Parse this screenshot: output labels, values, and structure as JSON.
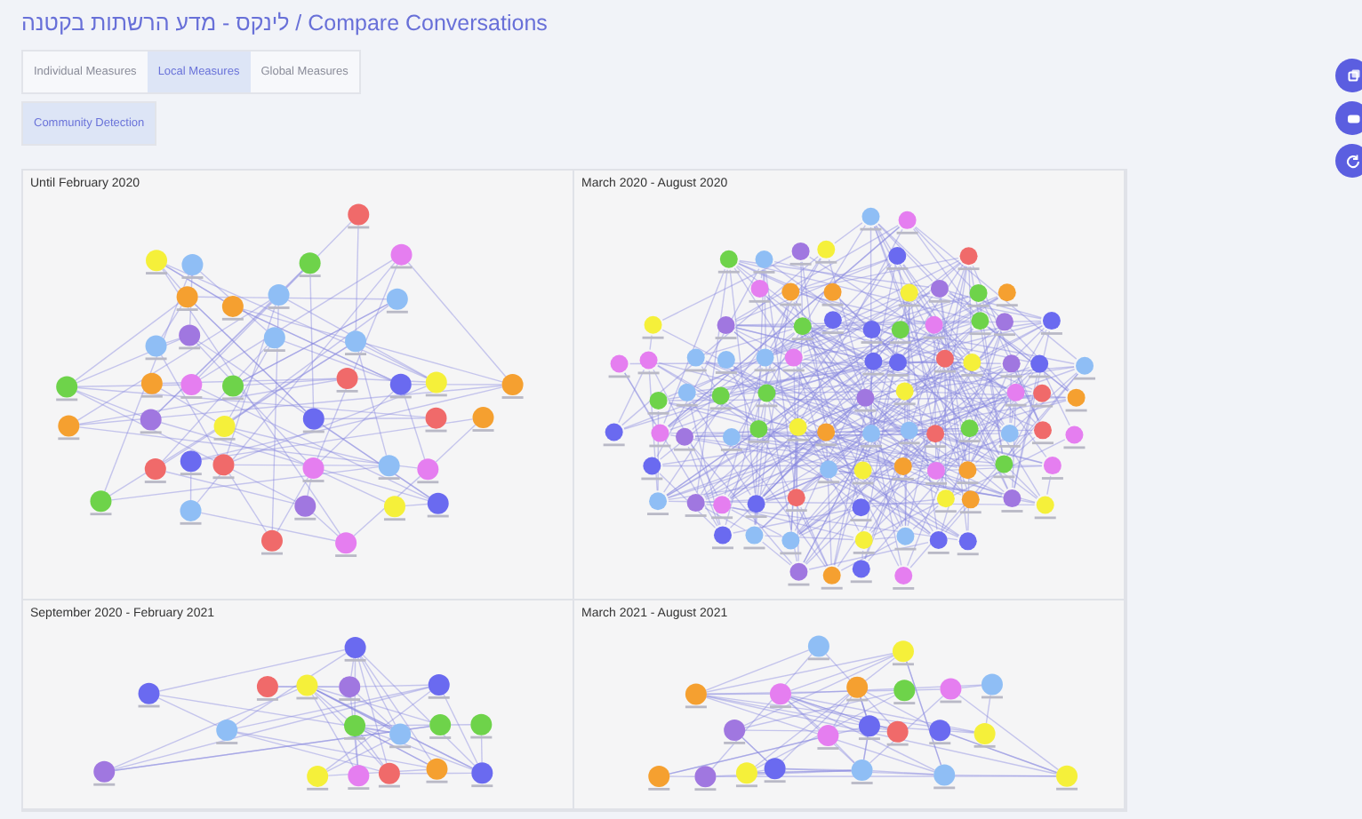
{
  "header": {
    "title": "לינקס - מדע הרשתות בקטנה / Compare Conversations"
  },
  "tabs": [
    {
      "label": "Individual Measures",
      "selected": false
    },
    {
      "label": "Local Measures",
      "selected": true
    },
    {
      "label": "Global Measures",
      "selected": false
    }
  ],
  "subtabs": [
    {
      "label": "Community Detection",
      "selected": true
    }
  ],
  "panels": [
    {
      "title": "Until February 2020"
    },
    {
      "title": "March 2020 - August 2020"
    },
    {
      "title": "September 2020 - February 2021"
    },
    {
      "title": "March 2021 - August 2021"
    }
  ],
  "side_buttons": [
    {
      "kind": "copy"
    },
    {
      "kind": "chat"
    },
    {
      "kind": "refresh"
    }
  ]
}
